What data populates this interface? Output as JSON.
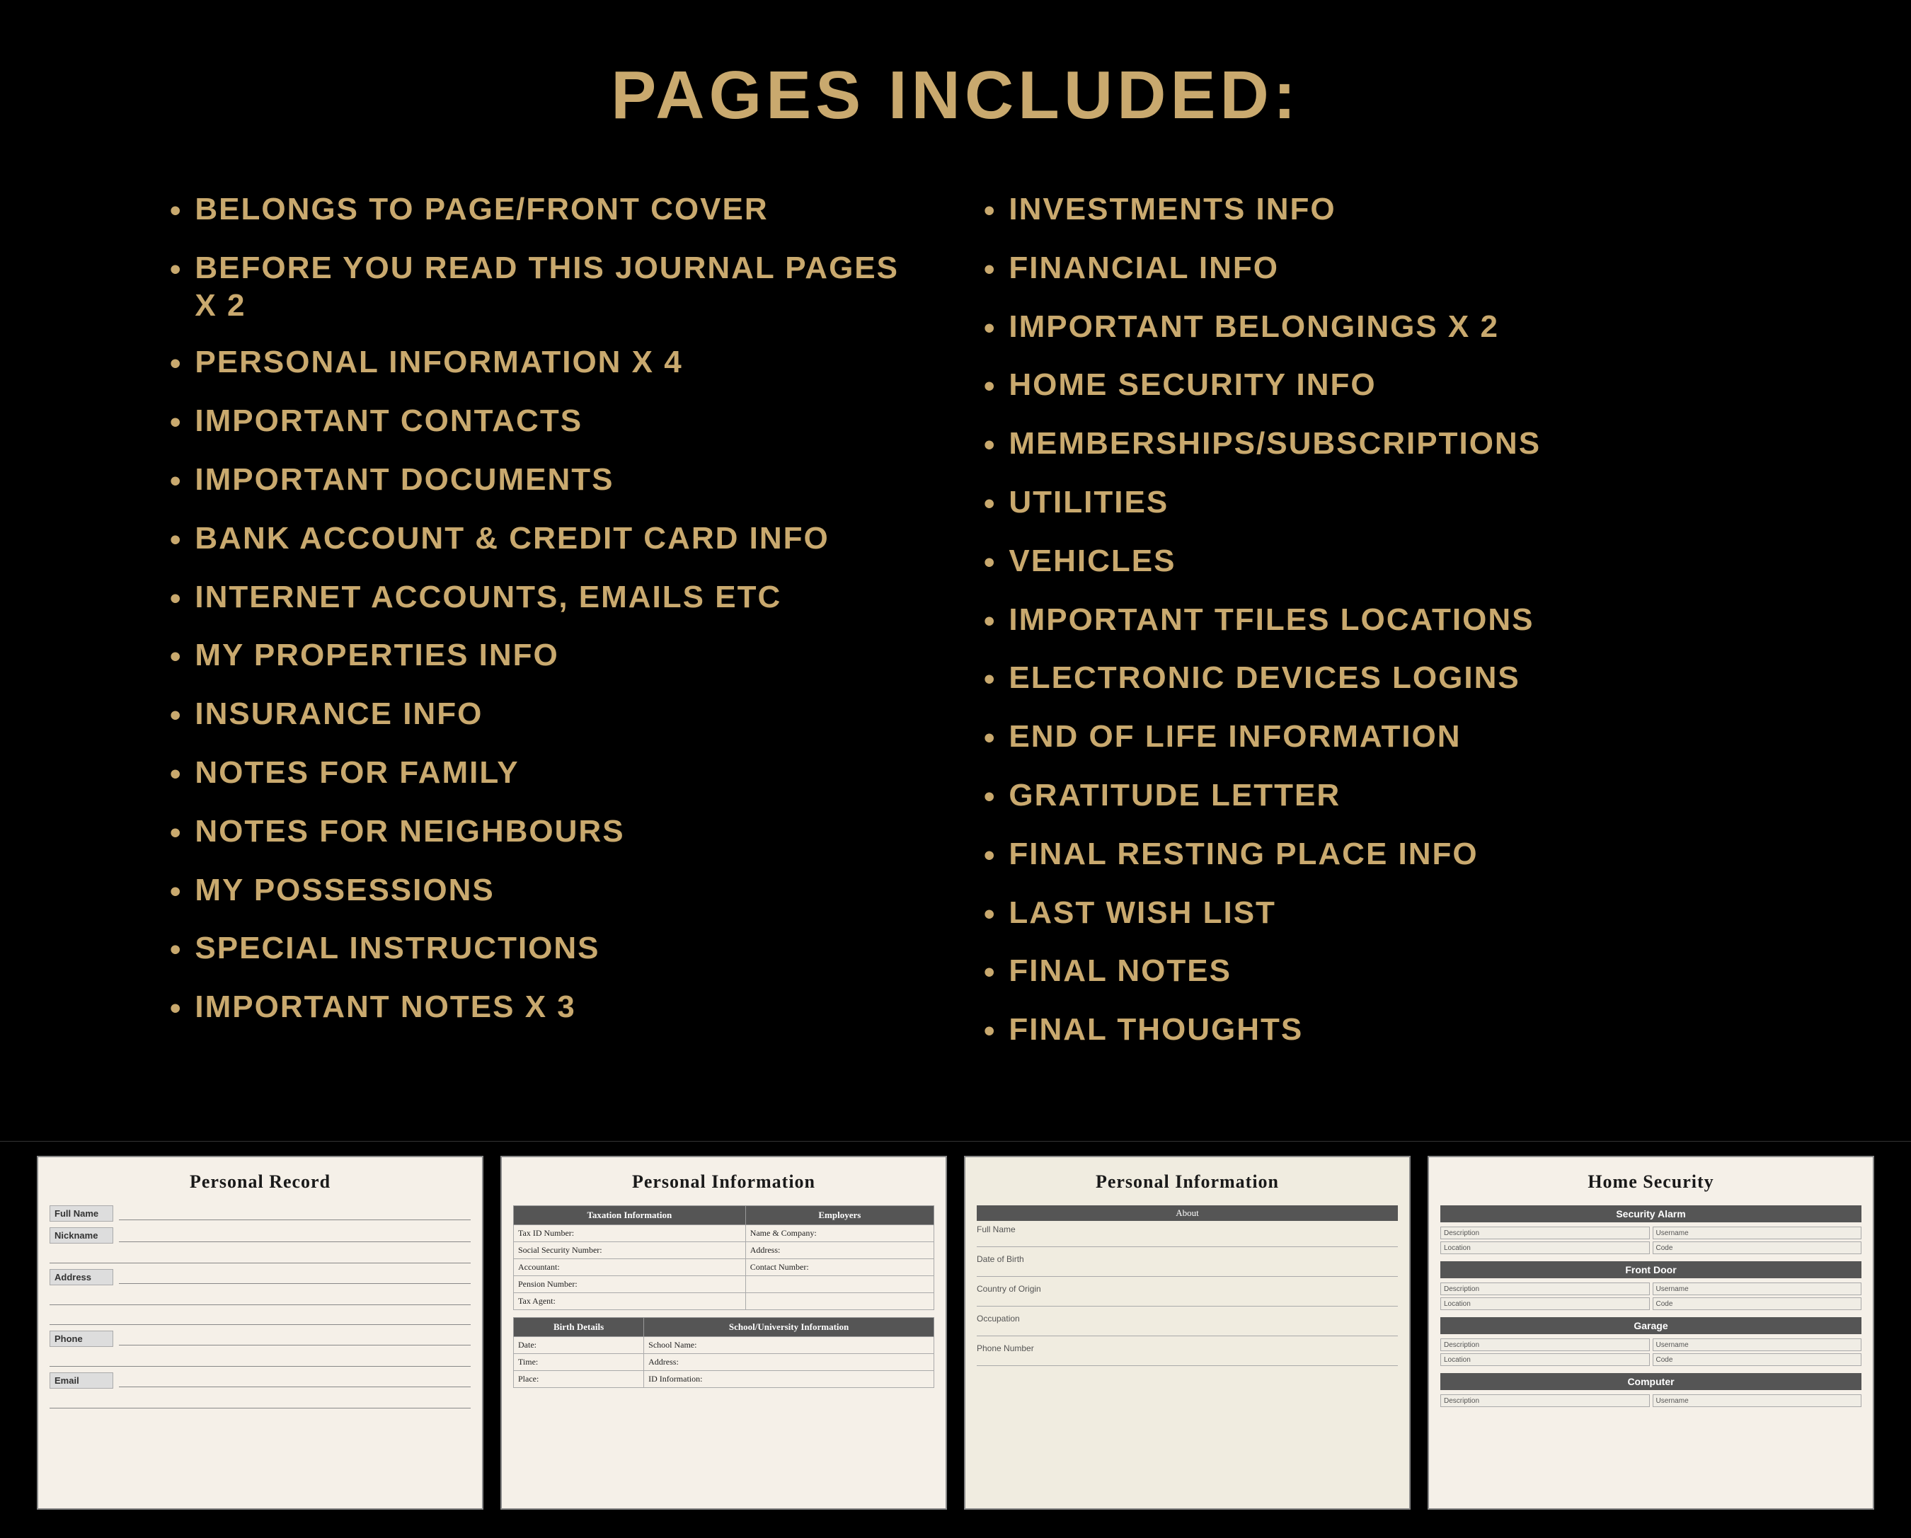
{
  "header": {
    "title": "PAGES INCLUDED:"
  },
  "left_column": [
    "BELONGS TO PAGE/FRONT COVER",
    "BEFORE YOU READ THIS JOURNAL PAGES X 2",
    "PERSONAL INFORMATION X 4",
    "IMPORTANT CONTACTS",
    "IMPORTANT DOCUMENTS",
    "BANK ACCOUNT & CREDIT CARD INFO",
    "INTERNET ACCOUNTS, EMAILS ETC",
    "MY PROPERTIES INFO",
    "INSURANCE INFO",
    "NOTES FOR FAMILY",
    "NOTES FOR NEIGHBOURS",
    "MY POSSESSIONS",
    "SPECIAL INSTRUCTIONS",
    "IMPORTANT NOTES X 3"
  ],
  "right_column": [
    "INVESTMENTS INFO",
    "FINANCIAL INFO",
    "IMPORTANT BELONGINGS X 2",
    "HOME SECURITY INFO",
    "MEMBERSHIPS/SUBSCRIPTIONS",
    "UTILITIES",
    "VEHICLES",
    "IMPORTANT TFILES LOCATIONS",
    " ELECTRONIC DEVICES LOGINS",
    "END OF LIFE INFORMATION",
    "GRATITUDE LETTER",
    "FINAL RESTING PLACE INFO",
    "LAST WISH LIST",
    "FINAL NOTES",
    "FINAL THOUGHTS"
  ],
  "previews": [
    {
      "title": "Personal Record",
      "type": "personal_record"
    },
    {
      "title": "Personal Information",
      "type": "personal_information"
    },
    {
      "title": "Personal Information",
      "type": "personal_information_2"
    },
    {
      "title": "Home Security",
      "type": "home_security"
    }
  ],
  "colors": {
    "accent": "#c9a96e",
    "background": "#000000",
    "page_bg": "#f5f0e8"
  }
}
